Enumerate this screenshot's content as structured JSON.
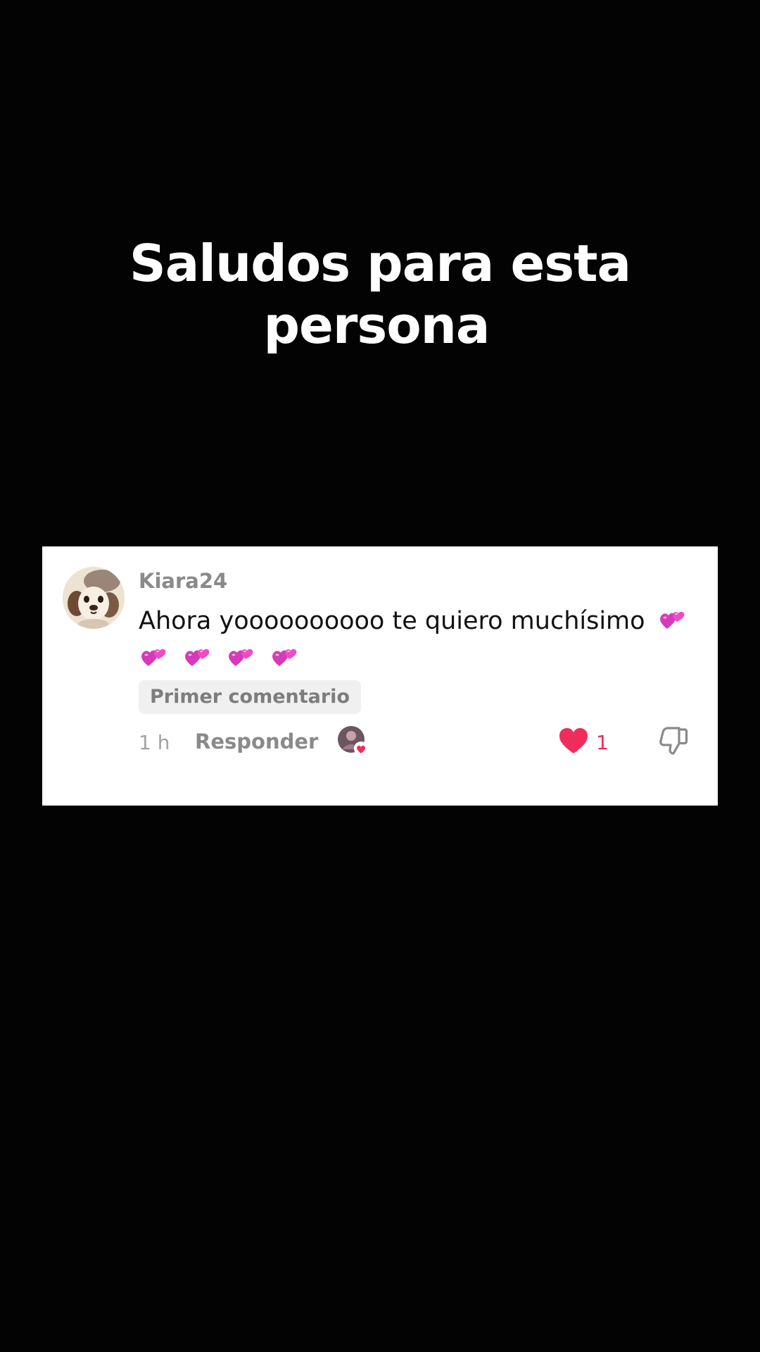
{
  "overlay": {
    "caption_line_1": "Saludos para esta",
    "caption_line_2": "persona"
  },
  "comment": {
    "username": "Kiara24",
    "text": "Ahora yoooooooooo te quiero muchísimo",
    "badge": "Primer comentario",
    "time": "1 h",
    "reply_label": "Responder",
    "like_count": "1",
    "emoji": "revolving-hearts-icon",
    "emoji_count": 5
  },
  "colors": {
    "background": "#030303",
    "card": "#ffffff",
    "like": "#f02d5a",
    "emoji": "#e23bc6"
  }
}
